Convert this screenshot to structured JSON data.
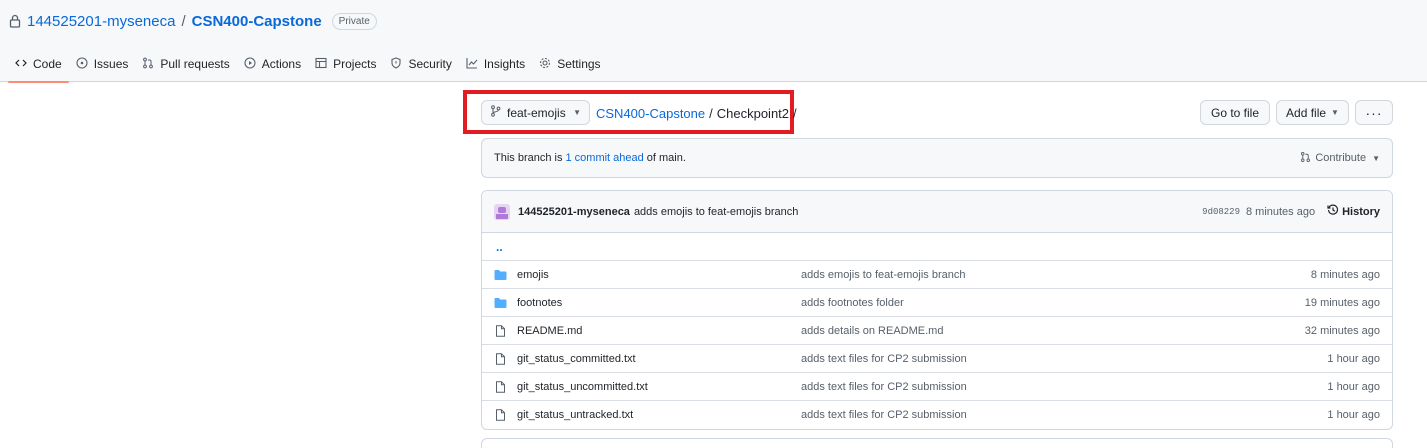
{
  "repo": {
    "owner": "144525201-myseneca",
    "separator": "/",
    "name": "CSN400-Capstone",
    "visibility": "Private"
  },
  "tabs": [
    {
      "label": "Code",
      "icon": "code-icon",
      "active": true
    },
    {
      "label": "Issues",
      "icon": "issue-icon"
    },
    {
      "label": "Pull requests",
      "icon": "pull-request-icon"
    },
    {
      "label": "Actions",
      "icon": "play-icon"
    },
    {
      "label": "Projects",
      "icon": "table-icon"
    },
    {
      "label": "Security",
      "icon": "shield-icon"
    },
    {
      "label": "Insights",
      "icon": "graph-icon"
    },
    {
      "label": "Settings",
      "icon": "gear-icon"
    }
  ],
  "toolbar": {
    "branch": "feat-emojis",
    "breadcrumb_repo": "CSN400-Capstone",
    "breadcrumb_sep": "/",
    "breadcrumb_dir": "Checkpoint2",
    "breadcrumb_trail": "/",
    "goto_file": "Go to file",
    "add_file": "Add file",
    "more": "···"
  },
  "ahead": {
    "prefix": "This branch is",
    "link": "1 commit ahead",
    "suffix": "of main.",
    "contribute": "Contribute"
  },
  "latest_commit": {
    "author": "144525201-myseneca",
    "message": "adds emojis to feat-emojis branch",
    "sha": "9d08229",
    "age": "8 minutes ago",
    "history": "History"
  },
  "parent_dir": "..",
  "files": [
    {
      "name": "emojis",
      "type": "folder",
      "message": "adds emojis to feat-emojis branch",
      "age": "8 minutes ago"
    },
    {
      "name": "footnotes",
      "type": "folder",
      "message": "adds footnotes folder",
      "age": "19 minutes ago"
    },
    {
      "name": "README.md",
      "type": "file",
      "message": "adds details on README.md",
      "age": "32 minutes ago"
    },
    {
      "name": "git_status_committed.txt",
      "type": "file",
      "message": "adds text files for CP2 submission",
      "age": "1 hour ago"
    },
    {
      "name": "git_status_uncommitted.txt",
      "type": "file",
      "message": "adds text files for CP2 submission",
      "age": "1 hour ago"
    },
    {
      "name": "git_status_untracked.txt",
      "type": "file",
      "message": "adds text files for CP2 submission",
      "age": "1 hour ago"
    }
  ],
  "colors": {
    "link": "#0969da",
    "active_tab_underline": "#fd8c73",
    "highlight": "#e31b23",
    "folder": "#54aeff"
  }
}
